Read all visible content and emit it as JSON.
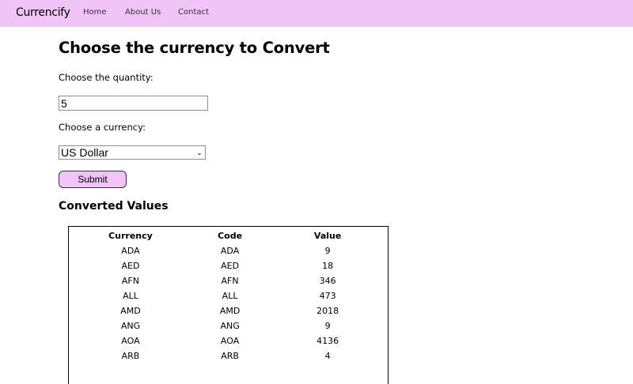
{
  "nav": {
    "brand": "Currencify",
    "links": [
      "Home",
      "About Us",
      "Contact"
    ]
  },
  "form": {
    "title": "Choose the currency to Convert",
    "quantity_label": "Choose the quantity:",
    "quantity_value": "5",
    "currency_label": "Choose a currency:",
    "currency_selected": "US Dollar",
    "submit_label": "Submit"
  },
  "results": {
    "title": "Converted Values",
    "headers": [
      "Currency",
      "Code",
      "Value"
    ],
    "rows": [
      [
        "ADA",
        "ADA",
        "9"
      ],
      [
        "AED",
        "AED",
        "18"
      ],
      [
        "AFN",
        "AFN",
        "346"
      ],
      [
        "ALL",
        "ALL",
        "473"
      ],
      [
        "AMD",
        "AMD",
        "2018"
      ],
      [
        "ANG",
        "ANG",
        "9"
      ],
      [
        "AOA",
        "AOA",
        "4136"
      ],
      [
        "ARB",
        "ARB",
        "4"
      ]
    ]
  },
  "colors": {
    "accent": "#f0c4f7"
  }
}
